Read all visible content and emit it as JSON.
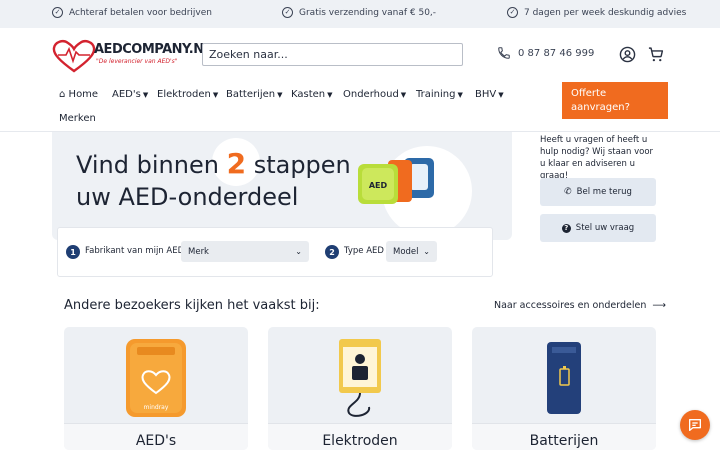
{
  "topbar": {
    "usps": [
      "Achteraf betalen voor bedrijven",
      "Gratis verzending vanaf € 50,-",
      "7 dagen per week deskundig advies"
    ]
  },
  "header": {
    "logo_text": "AEDCOMPANY.NL",
    "logo_tagline": "\"De leverancier van AED's\"",
    "search_placeholder": "Zoeken naar...",
    "phone": "0 87 87 46 999",
    "account_icon": "user-circle-icon",
    "cart_icon": "cart-icon"
  },
  "nav": {
    "home": "Home",
    "items": [
      "AED's",
      "Elektroden",
      "Batterijen",
      "Kasten",
      "Onderhoud",
      "Training",
      "BHV"
    ],
    "merken": "Merken",
    "offerte": "Offerte aanvragen?"
  },
  "hero": {
    "line1_a": "Vind binnen",
    "number": "2",
    "line1_b": "stappen",
    "line2": "uw AED-onderdeel"
  },
  "filter": {
    "step1_num": "1",
    "step1_label": "Fabrikant van mijn AED",
    "step1_select": "Merk",
    "step2_num": "2",
    "step2_label": "Type AED",
    "step2_select": "Model"
  },
  "help": {
    "text": "Heeft u vragen of heeft u hulp nodig? Wij staan voor u klaar en adviseren u graag!",
    "callback": "Bel me terug",
    "question": "Stel uw vraag"
  },
  "section": {
    "title": "Andere bezoekers kijken het vaakst bij:",
    "link": "Naar accessoires en onderdelen"
  },
  "cards": [
    "AED's",
    "Elektroden",
    "Batterijen"
  ],
  "colors": {
    "accent": "#f06b1f",
    "brand_red": "#d3232f",
    "navy": "#1f3e73",
    "light_bg": "#eef1f5"
  }
}
